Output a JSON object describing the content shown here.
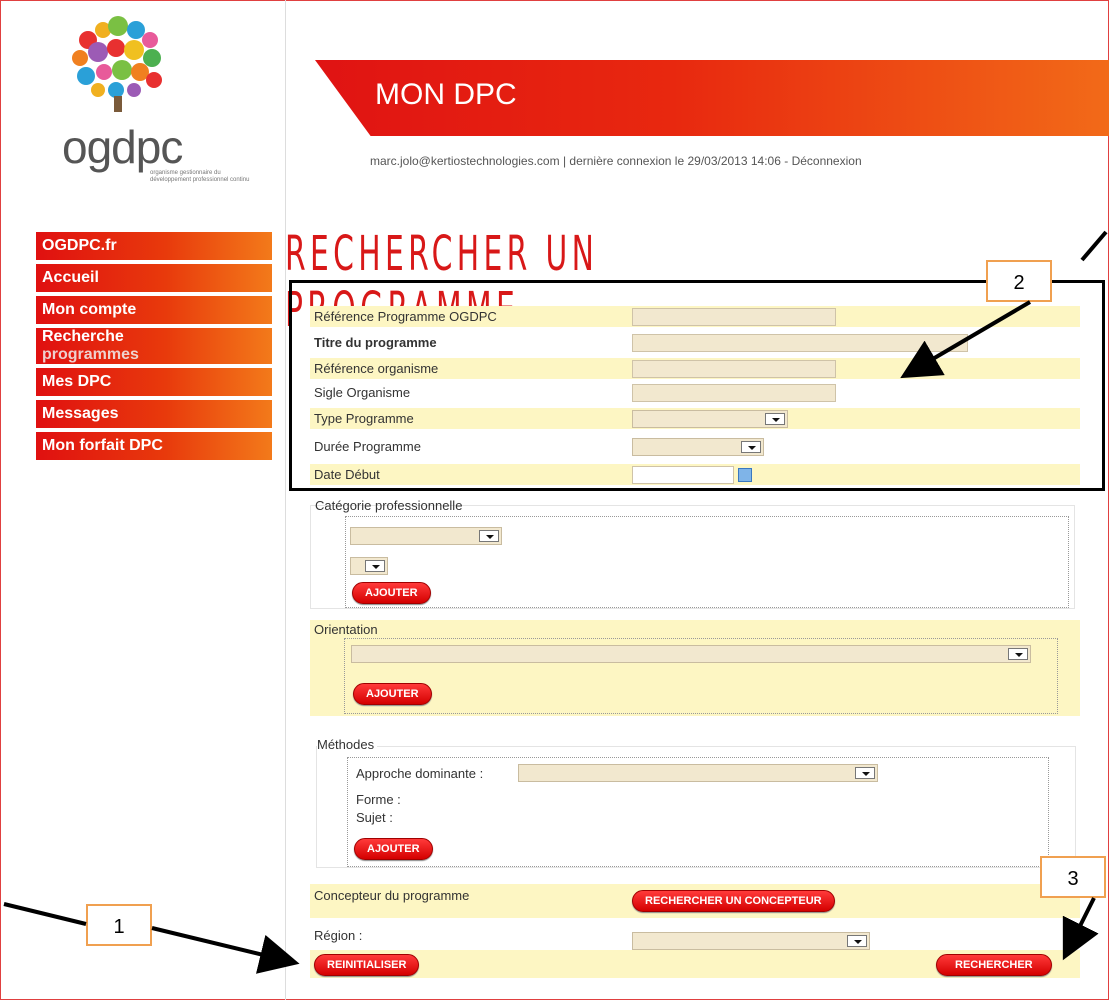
{
  "brand": {
    "logo_text": "ogdpc",
    "tagline": "organisme gestionnaire du développement professionnel continu"
  },
  "sidebar": {
    "items": [
      {
        "label": "OGDPC.fr"
      },
      {
        "label": "Accueil"
      },
      {
        "label": "Mon compte"
      },
      {
        "label": "Recherche",
        "sub": "programmes"
      },
      {
        "label": "Mes DPC"
      },
      {
        "label": "Messages"
      },
      {
        "label": "Mon forfait DPC"
      }
    ]
  },
  "header": {
    "title": "MON DPC",
    "email": "marc.jolo@kertiostechnologies.com",
    "last_login": "| dernière connexion le 29/03/2013 14:06 -",
    "logout": "Déconnexion"
  },
  "page_title": "RECHERCHER UN PROGRAMME",
  "form": {
    "ref_programme": {
      "label": "Référence Programme OGDPC",
      "value": ""
    },
    "titre": {
      "label": "Titre du programme",
      "value": ""
    },
    "ref_organisme": {
      "label": "Référence organisme",
      "value": ""
    },
    "sigle": {
      "label": "Sigle Organisme",
      "value": ""
    },
    "type": {
      "label": "Type Programme",
      "value": ""
    },
    "duree": {
      "label": "Durée Programme",
      "value": ""
    },
    "date_debut": {
      "label": "Date Début",
      "value": ""
    },
    "categorie": {
      "legend": "Catégorie professionnelle",
      "add_label": "AJOUTER"
    },
    "orientation": {
      "legend": "Orientation",
      "add_label": "AJOUTER"
    },
    "methodes": {
      "legend": "Méthodes",
      "approche_label": "Approche dominante :",
      "forme_label": "Forme :",
      "sujet_label": "Sujet :",
      "add_label": "AJOUTER"
    },
    "concepteur": {
      "label": "Concepteur du programme",
      "button": "RECHERCHER UN CONCEPTEUR"
    },
    "region": {
      "label": "Région :",
      "value": ""
    },
    "reset_label": "REINITIALISER",
    "search_label": "RECHERCHER"
  },
  "callouts": {
    "c1": "1",
    "c2": "2",
    "c3": "3"
  },
  "colors": {
    "accent": "#e01010",
    "row_highlight": "#fdf6c3",
    "input_bg": "#f2e8cf"
  }
}
